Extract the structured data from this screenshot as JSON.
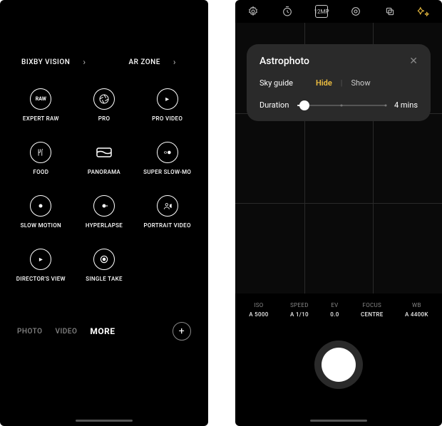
{
  "left": {
    "top_links": {
      "bixby": "BIXBY VISION",
      "ar": "AR ZONE"
    },
    "modes": [
      {
        "label": "EXPERT RAW",
        "icon": "raw"
      },
      {
        "label": "PRO",
        "icon": "aperture"
      },
      {
        "label": "PRO VIDEO",
        "icon": "play"
      },
      {
        "label": "FOOD",
        "icon": "food"
      },
      {
        "label": "PANORAMA",
        "icon": "panorama"
      },
      {
        "label": "SUPER SLOW-MO",
        "icon": "slow"
      },
      {
        "label": "SLOW MOTION",
        "icon": "slowmo"
      },
      {
        "label": "HYPERLAPSE",
        "icon": "hyper"
      },
      {
        "label": "PORTRAIT VIDEO",
        "icon": "portrait"
      },
      {
        "label": "DIRECTOR'S VIEW",
        "icon": "director"
      },
      {
        "label": "SINGLE TAKE",
        "icon": "single"
      }
    ],
    "tabs": {
      "photo": "PHOTO",
      "video": "VIDEO",
      "more": "MORE"
    }
  },
  "right": {
    "top": {
      "mp_badge": "12MP"
    },
    "panel": {
      "title": "Astrophoto",
      "sky_guide_label": "Sky guide",
      "hide": "Hide",
      "show": "Show",
      "duration_label": "Duration",
      "duration_value": "4 mins"
    },
    "pro": {
      "iso_label": "ISO",
      "iso_val": "A 5000",
      "speed_label": "SPEED",
      "speed_val": "A 1/10",
      "ev_label": "EV",
      "ev_val": "0.0",
      "focus_label": "FOCUS",
      "focus_val": "CENTRE",
      "wb_label": "WB",
      "wb_val": "A 4400K"
    }
  }
}
